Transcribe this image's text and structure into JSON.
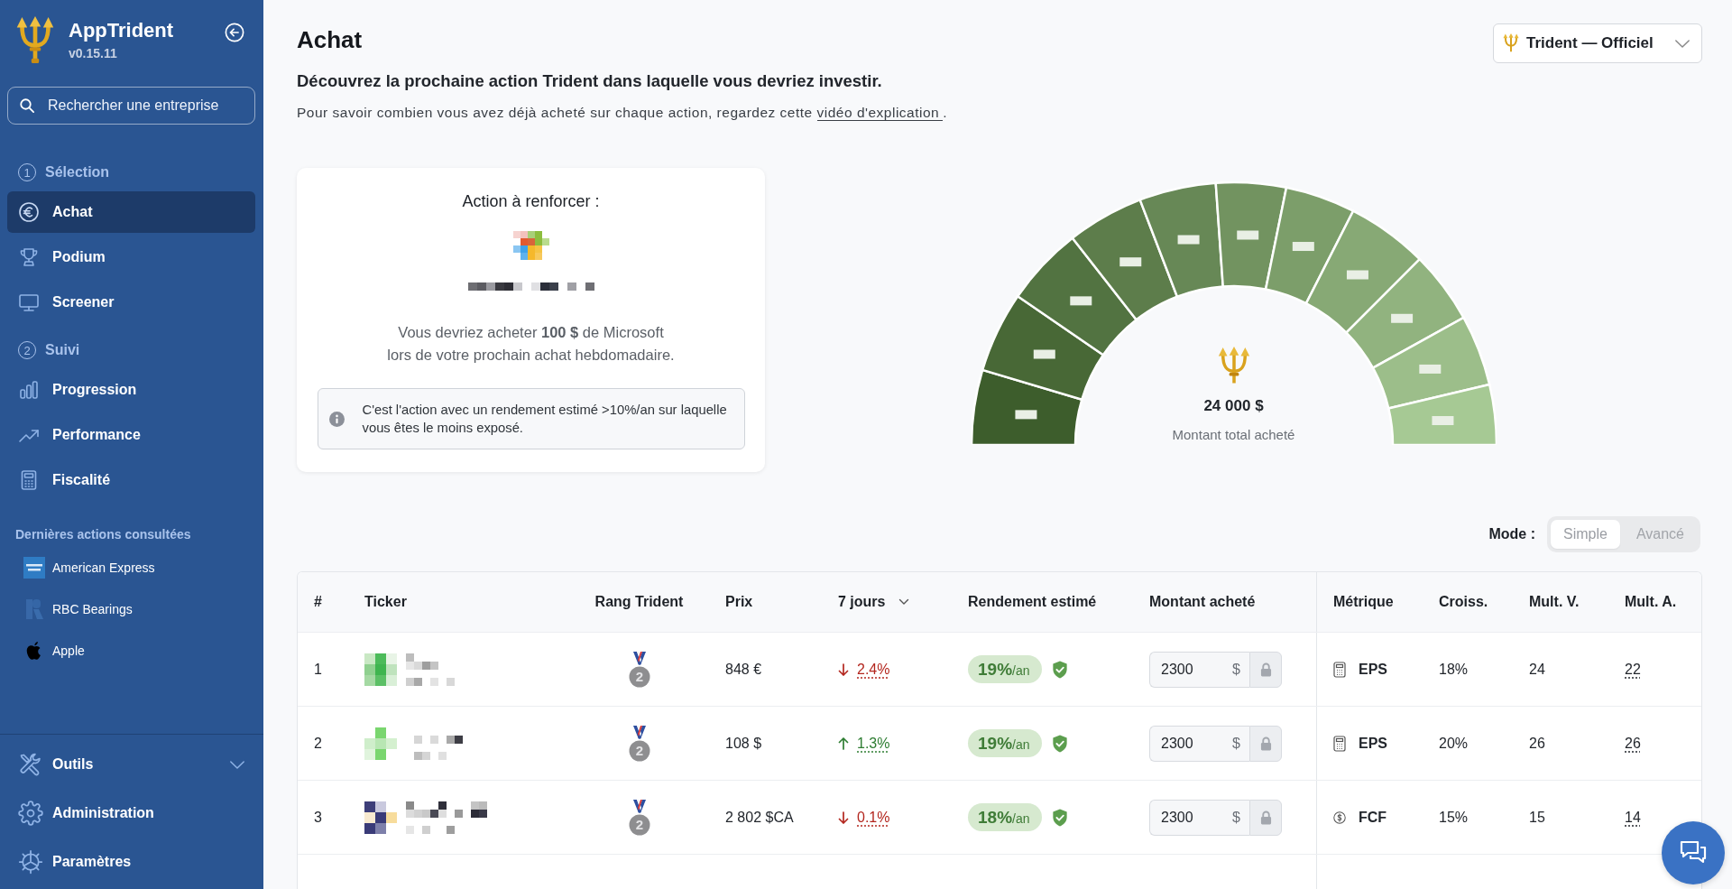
{
  "sidebar": {
    "app_name": "AppTrident",
    "version": "v0.15.11",
    "search": {
      "placeholder": "Rechercher une entreprise"
    },
    "sections": [
      {
        "number": "1",
        "title": "Sélection",
        "items": [
          {
            "label": "Achat",
            "selected": true
          },
          {
            "label": "Podium",
            "selected": false
          },
          {
            "label": "Screener",
            "selected": false
          }
        ]
      },
      {
        "number": "2",
        "title": "Suivi",
        "items": [
          {
            "label": "Progression",
            "selected": false
          },
          {
            "label": "Performance",
            "selected": false
          },
          {
            "label": "Fiscalité",
            "selected": false
          }
        ]
      }
    ],
    "recent": {
      "title": "Dernières actions consultées",
      "items": [
        {
          "name": "American Express"
        },
        {
          "name": "RBC Bearings"
        },
        {
          "name": "Apple"
        }
      ]
    },
    "footer_items": [
      {
        "label": "Outils",
        "kind": "group",
        "expanded": false
      },
      {
        "label": "Administration",
        "kind": "link"
      },
      {
        "label": "Paramètres",
        "kind": "link"
      }
    ]
  },
  "header": {
    "title": "Achat",
    "subtitle": "Découvrez la prochaine action Trident dans laquelle vous devriez investir.",
    "help": {
      "before": "Pour savoir combien vous avez déjà acheté sur chaque action, regardez cette ",
      "link": "vidéo d'explication",
      "after": "."
    }
  },
  "strategy_select": {
    "value": "Trident — Officiel"
  },
  "recommendation": {
    "title": "Action à renforcer :",
    "message": "Vous devriez acheter **100 $** de Microsoft\nlors de votre prochain achat hebdomadaire.",
    "note": "C'est l'action avec un rendement estimé >10%/an sur laquelle\nvous êtes le moins exposé."
  },
  "allocation": {
    "total": "24 000 $",
    "total_label": "Montant total acheté"
  },
  "mode": {
    "label": "Mode :",
    "options": [
      {
        "label": "Simple",
        "selected": true
      },
      {
        "label": "Avancé",
        "selected": false
      }
    ]
  },
  "table": {
    "columns": [
      {
        "label": "#",
        "sorted": false
      },
      {
        "label": "Ticker",
        "sorted": false
      },
      {
        "label": "Rang Trident",
        "sorted": false
      },
      {
        "label": "Prix",
        "sorted": false
      },
      {
        "label": "7 jours",
        "sorted": true
      },
      {
        "label": "Rendement estimé",
        "sorted": false
      },
      {
        "label": "Montant acheté",
        "sorted": false
      },
      {
        "label": "Métrique",
        "sorted": false
      },
      {
        "label": "Croiss.",
        "sorted": false
      },
      {
        "label": "Mult. V.",
        "sorted": false
      },
      {
        "label": "Mult. A.",
        "sorted": false
      }
    ],
    "rows": [
      {
        "number": "1",
        "medal": {
          "rank": "2",
          "color": "#8e8e90"
        },
        "price": "848 €",
        "change": {
          "rising": false,
          "value": "2.4%"
        },
        "return": {
          "value": "19%",
          "unit": "/an",
          "verified": true
        },
        "amount": {
          "value": "2300",
          "currency": "$",
          "locked": true
        },
        "metric": {
          "kind": "earnings",
          "label": "EPS"
        },
        "growth": "18%",
        "mult_v": "24",
        "mult_a": "22"
      },
      {
        "number": "2",
        "medal": {
          "rank": "2",
          "color": "#8e8e90"
        },
        "price": "108 $",
        "change": {
          "rising": true,
          "value": "1.3%"
        },
        "return": {
          "value": "19%",
          "unit": "/an",
          "verified": true
        },
        "amount": {
          "value": "2300",
          "currency": "$",
          "locked": true
        },
        "metric": {
          "kind": "earnings",
          "label": "EPS"
        },
        "growth": "20%",
        "mult_v": "26",
        "mult_a": "26"
      },
      {
        "number": "3",
        "medal": {
          "rank": "2",
          "color": "#8e8e90"
        },
        "price": "2 802 $CA",
        "change": {
          "rising": false,
          "value": "0.1%"
        },
        "return": {
          "value": "18%",
          "unit": "/an",
          "verified": true
        },
        "amount": {
          "value": "2300",
          "currency": "$",
          "locked": true
        },
        "metric": {
          "kind": "cashflow",
          "label": "FCF"
        },
        "growth": "15%",
        "mult_v": "15",
        "mult_a": "14"
      }
    ]
  }
}
